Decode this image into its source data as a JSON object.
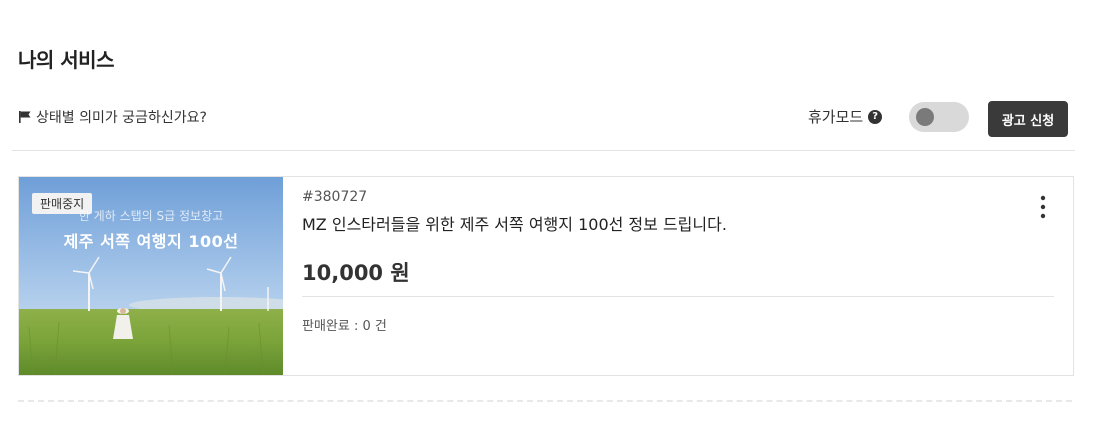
{
  "header": {
    "title": "나의 서비스",
    "status_help": "상태별 의미가 궁금하신가요?",
    "vacation_mode_label": "휴가모드",
    "vacation_mode_on": false,
    "ad_button_label": "광고 신청"
  },
  "services": [
    {
      "status": "판매중지",
      "thumbnail_subtitle": "한 게하 스탭의 S급 정보창고",
      "thumbnail_title": "제주 서쪽 여행지 100선",
      "id": "#380727",
      "title": "MZ 인스타러들을 위한 제주 서쪽 여행지 100선 정보 드립니다.",
      "price": "10,000 원",
      "sales": "판매완료 : 0 건"
    }
  ],
  "icons": {
    "flag": "flag-icon",
    "help": "question-circle-icon",
    "more": "more-vertical-icon"
  },
  "colors": {
    "button_dark": "#3a3a3a",
    "toggle_off": "#d9d9d9"
  }
}
